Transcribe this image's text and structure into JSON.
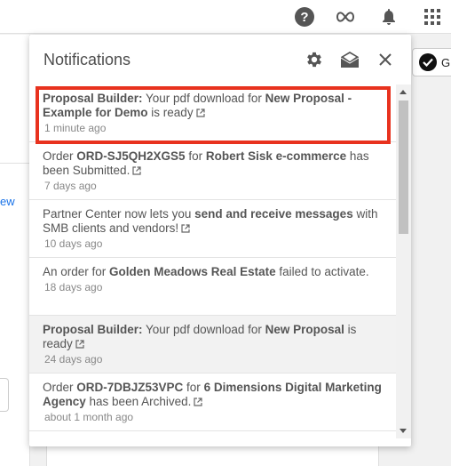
{
  "topbar": {
    "icons": [
      "help-icon",
      "link-icon",
      "notifications-bell-icon",
      "apps-grid-icon"
    ],
    "help_glyph": "?"
  },
  "background": {
    "left_link_text": "ew",
    "right_chip_text": "G"
  },
  "panel": {
    "title": "Notifications",
    "header_icons": [
      "settings-gear-icon",
      "mark-all-read-icon",
      "close-icon"
    ]
  },
  "notifications": [
    {
      "parts": [
        [
          "b",
          "Proposal Builder:"
        ],
        [
          "t",
          " Your pdf download for "
        ],
        [
          "b",
          "New Proposal - Example for Demo"
        ],
        [
          "t",
          " is ready"
        ]
      ],
      "time": "1 minute ago",
      "external_link": true,
      "unread": false
    },
    {
      "parts": [
        [
          "t",
          "Order "
        ],
        [
          "b",
          "ORD-SJ5QH2XGS5"
        ],
        [
          "t",
          " for "
        ],
        [
          "b",
          "Robert Sisk e-commerce"
        ],
        [
          "t",
          " has been Submitted."
        ]
      ],
      "time": "7 days ago",
      "external_link": true,
      "unread": false
    },
    {
      "parts": [
        [
          "t",
          "Partner Center now lets you "
        ],
        [
          "b",
          "send and receive messages"
        ],
        [
          "t",
          " with SMB clients and vendors!"
        ]
      ],
      "time": "10 days ago",
      "external_link": true,
      "unread": false
    },
    {
      "parts": [
        [
          "t",
          "An order for "
        ],
        [
          "b",
          "Golden Meadows Real Estate"
        ],
        [
          "t",
          " failed to activate."
        ]
      ],
      "time": "18 days ago",
      "external_link": false,
      "unread": false
    },
    {
      "parts": [
        [
          "b",
          "Proposal Builder:"
        ],
        [
          "t",
          " Your pdf download for "
        ],
        [
          "b",
          "New Proposal"
        ],
        [
          "t",
          " is ready"
        ]
      ],
      "time": "24 days ago",
      "external_link": true,
      "unread": true
    },
    {
      "parts": [
        [
          "t",
          "Order "
        ],
        [
          "b",
          "ORD-7DBJZ53VPC"
        ],
        [
          "t",
          " for "
        ],
        [
          "b",
          "6 Dimensions Digital Marketing Agency"
        ],
        [
          "t",
          " has been Archived."
        ]
      ],
      "time": "about 1 month ago",
      "external_link": true,
      "unread": false
    }
  ],
  "colors": {
    "highlight_border": "#e8321e",
    "unread_background": "#f2f2f2"
  }
}
